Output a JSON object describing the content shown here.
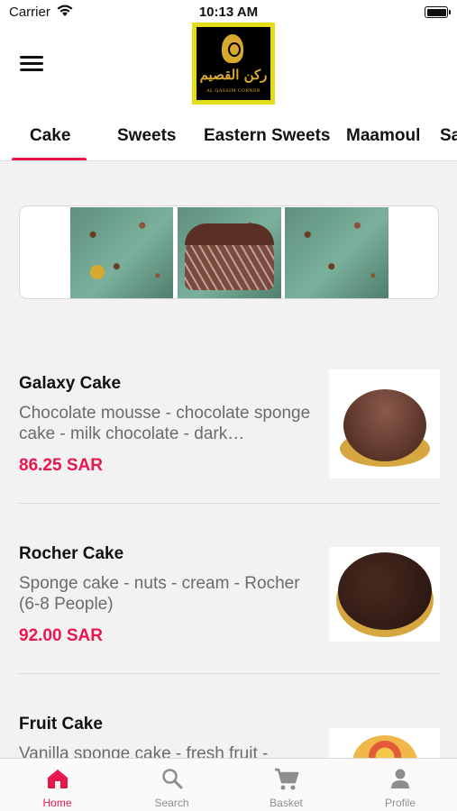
{
  "status_bar": {
    "carrier": "Carrier",
    "time": "10:13 AM"
  },
  "header": {
    "logo_arabic": "ركن القصيم",
    "logo_english": "AL QASSIM CORNER"
  },
  "tabs": [
    {
      "label": "Cake",
      "active": true
    },
    {
      "label": "Sweets",
      "active": false
    },
    {
      "label": "Eastern Sweets",
      "active": false
    },
    {
      "label": "Maamoul",
      "active": false
    },
    {
      "label": "Sa",
      "active": false
    }
  ],
  "products": [
    {
      "name": "Galaxy Cake",
      "description": "Chocolate mousse - chocolate sponge cake - milk chocolate - dark…",
      "price": "86.25 SAR"
    },
    {
      "name": "Rocher Cake",
      "description": "Sponge cake - nuts - cream - Rocher (6-8 People)",
      "price": "92.00 SAR"
    },
    {
      "name": "Fruit Cake",
      "description": "Vanilla sponge cake - fresh fruit -",
      "price": ""
    }
  ],
  "bottom_nav": [
    {
      "label": "Home",
      "icon": "home-icon",
      "active": true
    },
    {
      "label": "Search",
      "icon": "search-icon",
      "active": false
    },
    {
      "label": "Basket",
      "icon": "cart-icon",
      "active": false
    },
    {
      "label": "Profile",
      "icon": "person-icon",
      "active": false
    }
  ],
  "colors": {
    "accent": "#e8184f",
    "logo_frame": "#e3dc16",
    "logo_gold": "#d8a92f"
  }
}
